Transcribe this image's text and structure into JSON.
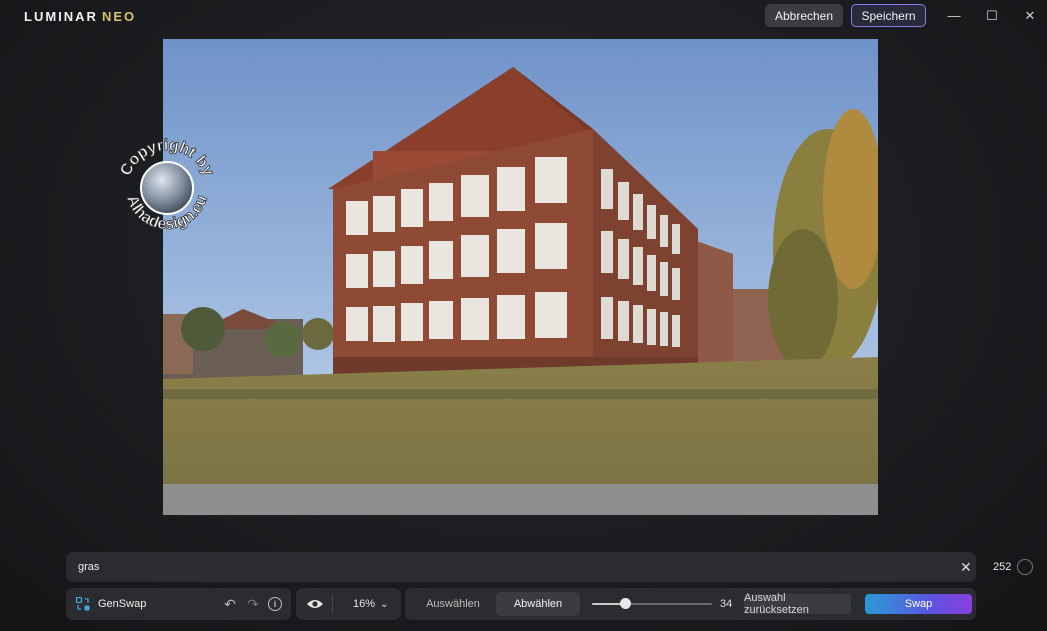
{
  "app": {
    "logo_main": "LUMINAR",
    "logo_accent": "NEO"
  },
  "header": {
    "cancel_label": "Abbrechen",
    "save_label": "Speichern"
  },
  "window_controls": {
    "minimize": "—",
    "maximize": "☐",
    "close": "✕"
  },
  "watermark": {
    "text": "Copyright by Alhadesign.eu"
  },
  "prompt": {
    "value": "gras",
    "clear_icon": "✕",
    "count": "252"
  },
  "tool": {
    "name": "GenSwap",
    "undo_icon": "↶",
    "redo_icon": "↷",
    "info_icon": "i"
  },
  "view": {
    "zoom": "16%",
    "zoom_chevron": "⌄"
  },
  "mode": {
    "select_label": "Auswählen",
    "deselect_label": "Abwählen",
    "active": "Abwählen",
    "brush_size": "34",
    "brush_fraction": 0.28,
    "reset_label": "Auswahl zurücksetzen",
    "swap_label": "Swap"
  },
  "colors": {
    "accent_purple": "#8a7cf0",
    "swap_gradient_start": "#2a9ad6",
    "swap_gradient_end": "#8a3fe0"
  }
}
